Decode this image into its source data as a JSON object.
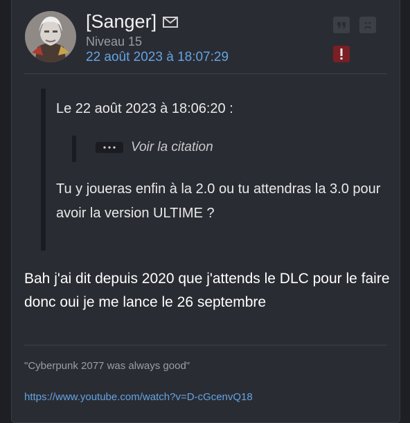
{
  "author": {
    "name": "[Sanger]",
    "level": "Niveau 15",
    "date": "22 août 2023 à 18:07:29"
  },
  "quote": {
    "header": "Le 22 août 2023 à 18:06:20 :",
    "view_label": "Voir la citation",
    "text": "Tu y joueras enfin à la 2.0 ou tu attendras la 3.0 pour avoir la version ULTIME ?"
  },
  "body": {
    "text": "Bah j'ai dit depuis 2020 que j'attends le DLC pour le faire donc oui je me lance le 26 septembre"
  },
  "signature": {
    "quote": "\"Cyberpunk 2077 was always good\"",
    "link": "https://www.youtube.com/watch?v=D-cGcenvQ18"
  },
  "icons": {
    "mail": "mail-icon",
    "quote": "quote-icon",
    "sad": "sad-face-icon",
    "report": "exclamation-icon",
    "dots": "ellipsis-icon"
  },
  "colors": {
    "card_bg": "#2a2c33",
    "link": "#63a4e4",
    "report": "#7a1f24"
  }
}
